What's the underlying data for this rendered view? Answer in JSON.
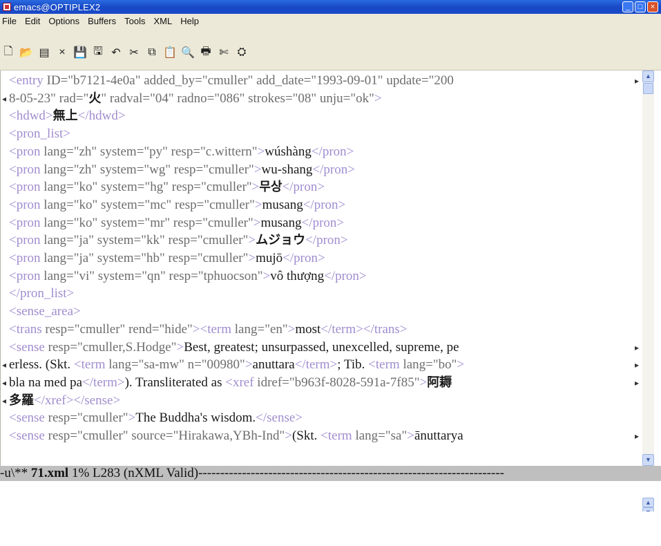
{
  "window": {
    "title": "emacs@OPTIPLEX2",
    "buttons": [
      "_",
      "□",
      "×"
    ]
  },
  "menu": [
    "File",
    "Edit",
    "Options",
    "Buffers",
    "Tools",
    "XML",
    "Help"
  ],
  "toolbar_icons": [
    "new-file-icon",
    "open-folder-icon",
    "dired-icon",
    "close-buffer-icon",
    "save-icon",
    "save-as-icon",
    "undo-icon",
    "cut-icon",
    "copy-icon",
    "paste-icon",
    "search-icon",
    "print-icon",
    "customize-icon",
    "help-icon"
  ],
  "toolbar_glyphs": [
    "🗋",
    "📂",
    "▤",
    "×",
    "💾",
    "🖫",
    "↶",
    "✂",
    "⧉",
    "📋",
    "🔍",
    "🖶",
    "✄",
    "⛭"
  ],
  "editor_lines": [
    {
      "parts": [
        [
          "t",
          "<entry "
        ],
        [
          "a",
          "ID=\"b7121-4e0a\" added_by=\"cmuller\" add_date=\"1993-09-01\" update=\"200"
        ]
      ],
      "wrap_right": true
    },
    {
      "parts": [
        [
          "a",
          "8-05-23\" rad=\""
        ],
        [
          "c",
          "火"
        ],
        [
          "a",
          "\" radval=\"04\" radno=\"086\" strokes=\"08\" unju=\"ok\""
        ],
        [
          "t",
          ">"
        ]
      ],
      "wrap_left": true
    },
    {
      "parts": [
        [
          "t",
          "<hdwd>"
        ],
        [
          "c",
          "無上"
        ],
        [
          "t",
          "</hdwd>"
        ]
      ]
    },
    {
      "parts": [
        [
          "t",
          "<pron_list>"
        ]
      ]
    },
    {
      "parts": [
        [
          "t",
          "<pron "
        ],
        [
          "a",
          "lang=\"zh\" system=\"py\" resp=\"c.wittern\""
        ],
        [
          "t",
          ">"
        ],
        [
          "x",
          "wúshàng"
        ],
        [
          "t",
          "</pron>"
        ]
      ]
    },
    {
      "parts": [
        [
          "t",
          "<pron "
        ],
        [
          "a",
          "lang=\"zh\" system=\"wg\" resp=\"cmuller\""
        ],
        [
          "t",
          ">"
        ],
        [
          "x",
          "wu-shang"
        ],
        [
          "t",
          "</pron>"
        ]
      ]
    },
    {
      "parts": [
        [
          "t",
          "<pron "
        ],
        [
          "a",
          "lang=\"ko\" system=\"hg\" resp=\"cmuller\""
        ],
        [
          "t",
          ">"
        ],
        [
          "c",
          "무상"
        ],
        [
          "t",
          "</pron>"
        ]
      ]
    },
    {
      "parts": [
        [
          "t",
          "<pron "
        ],
        [
          "a",
          "lang=\"ko\" system=\"mc\" resp=\"cmuller\""
        ],
        [
          "t",
          ">"
        ],
        [
          "x",
          "musang"
        ],
        [
          "t",
          "</pron>"
        ]
      ]
    },
    {
      "parts": [
        [
          "t",
          "<pron "
        ],
        [
          "a",
          "lang=\"ko\" system=\"mr\" resp=\"cmuller\""
        ],
        [
          "t",
          ">"
        ],
        [
          "x",
          "musang"
        ],
        [
          "t",
          "</pron>"
        ]
      ]
    },
    {
      "parts": [
        [
          "t",
          "<pron "
        ],
        [
          "a",
          "lang=\"ja\" system=\"kk\" resp=\"cmuller\""
        ],
        [
          "t",
          ">"
        ],
        [
          "c",
          "ムジョウ"
        ],
        [
          "t",
          "</pron>"
        ]
      ]
    },
    {
      "parts": [
        [
          "t",
          "<pron "
        ],
        [
          "a",
          "lang=\"ja\" system=\"hb\" resp=\"cmuller\""
        ],
        [
          "t",
          ">"
        ],
        [
          "x",
          "mujō"
        ],
        [
          "t",
          "</pron>"
        ]
      ]
    },
    {
      "parts": [
        [
          "t",
          "<pron "
        ],
        [
          "a",
          "lang=\"vi\" system=\"qn\" resp=\"tphuocson\""
        ],
        [
          "t",
          ">"
        ],
        [
          "x",
          "vô thượng"
        ],
        [
          "t",
          "</pron>"
        ]
      ]
    },
    {
      "parts": [
        [
          "t",
          "</pron_list>"
        ]
      ]
    },
    {
      "parts": [
        [
          "t",
          "<sense_area>"
        ]
      ]
    },
    {
      "parts": [
        [
          "t",
          "<trans "
        ],
        [
          "a",
          "resp=\"cmuller\" rend=\"hide\""
        ],
        [
          "t",
          "><term "
        ],
        [
          "a",
          "lang=\"en\""
        ],
        [
          "t",
          ">"
        ],
        [
          "x",
          "most"
        ],
        [
          "t",
          "</term></trans>"
        ]
      ]
    },
    {
      "parts": [
        [
          "t",
          "<sense "
        ],
        [
          "a",
          "resp=\"cmuller,S.Hodge\""
        ],
        [
          "t",
          ">"
        ],
        [
          "x",
          "Best, greatest; unsurpassed, unexcelled, supreme, pe"
        ]
      ],
      "wrap_right": true
    },
    {
      "parts": [
        [
          "x",
          "erless. (Skt. "
        ],
        [
          "t",
          "<term "
        ],
        [
          "a",
          "lang=\"sa-mw\" n=\"00980\""
        ],
        [
          "t",
          ">"
        ],
        [
          "x",
          "anuttara"
        ],
        [
          "t",
          "</term>"
        ],
        [
          "x",
          "; Tib. "
        ],
        [
          "t",
          "<term "
        ],
        [
          "a",
          "lang=\"bo\""
        ],
        [
          "t",
          ">"
        ]
      ],
      "wrap_left": true,
      "wrap_right": true
    },
    {
      "parts": [
        [
          "x",
          "bla na med pa"
        ],
        [
          "t",
          "</term>"
        ],
        [
          "x",
          "). Transliterated as "
        ],
        [
          "t",
          "<xref "
        ],
        [
          "a",
          "idref=\"b963f-8028-591a-7f85\""
        ],
        [
          "t",
          ">"
        ],
        [
          "c",
          "阿耨"
        ]
      ],
      "wrap_left": true,
      "wrap_right": true
    },
    {
      "parts": [
        [
          "c",
          "多羅"
        ],
        [
          "t",
          "</xref></sense>"
        ]
      ],
      "wrap_left": true
    },
    {
      "parts": [
        [
          "t",
          "<sense "
        ],
        [
          "a",
          "resp=\"cmuller\""
        ],
        [
          "t",
          ">"
        ],
        [
          "x",
          "The Buddha's wisdom."
        ],
        [
          "t",
          "</sense>"
        ]
      ]
    },
    {
      "parts": [
        [
          "t",
          "<sense "
        ],
        [
          "a",
          "resp=\"cmuller\" source=\"Hirakawa,YBh-Ind\""
        ],
        [
          "t",
          ">"
        ],
        [
          "x",
          "(Skt. "
        ],
        [
          "t",
          "<term "
        ],
        [
          "a",
          "lang=\"sa\""
        ],
        [
          "t",
          ">"
        ],
        [
          "x",
          "ānuttarya"
        ]
      ],
      "wrap_right": true
    }
  ],
  "modeline": {
    "prefix": "-u\\** ",
    "buffer": "71.xml",
    "rest": "        1% L283   (nXML Valid)----------------------------------------------------------------------"
  },
  "scroll_arrows": {
    "up": "▲",
    "down": "▼"
  },
  "wrap_glyph": {
    "right": "▸",
    "left": "◂"
  },
  "colors": {
    "tag": "#a08dcf",
    "attr": "#6d6d6d",
    "titlebar": "#1747c4",
    "chrome": "#ece9d8",
    "modeline": "#bfbfbf"
  }
}
